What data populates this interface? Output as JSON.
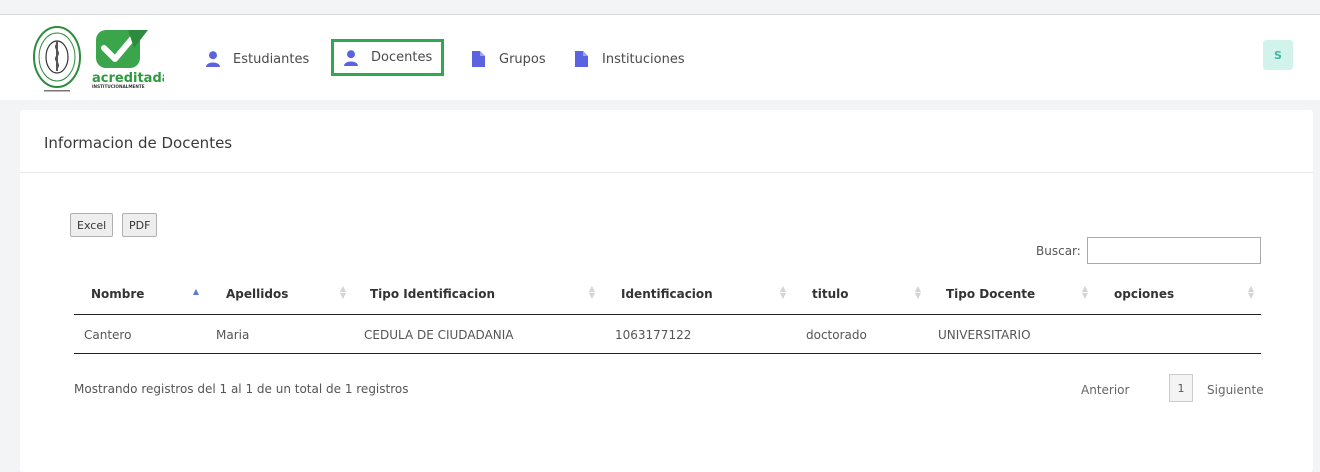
{
  "colors": {
    "nav_active_border": "#2fa84f",
    "nav_icon_blue": "#5b63e0",
    "avatar_bg": "#d2f3ec",
    "avatar_text": "#40b8a0"
  },
  "header": {
    "logo_text": "acreditada",
    "logo_subtext": "INSTITUCIONALMENTE",
    "nav": [
      {
        "label": "Estudiantes",
        "icon": "person-icon"
      },
      {
        "label": "Docentes",
        "icon": "person-icon",
        "active": true
      },
      {
        "label": "Grupos",
        "icon": "document-icon"
      },
      {
        "label": "Instituciones",
        "icon": "document-icon"
      }
    ],
    "avatar_initial": "S"
  },
  "card": {
    "title": "Informacion de Docentes",
    "buttons": {
      "excel": "Excel",
      "pdf": "PDF"
    },
    "search_label": "Buscar:",
    "table": {
      "columns": [
        "Nombre",
        "Apellidos",
        "Tipo Identificacion",
        "Identificacion",
        "titulo",
        "Tipo Docente",
        "opciones"
      ],
      "rows": [
        [
          "Cantero",
          "Maria",
          "CEDULA DE CIUDADANIA",
          "1063177122",
          "doctorado",
          "UNIVERSITARIO",
          ""
        ]
      ]
    },
    "info": "Mostrando registros del 1 al 1 de un total de 1 registros",
    "pagination": {
      "prev": "Anterior",
      "current": "1",
      "next": "Siguiente"
    }
  }
}
